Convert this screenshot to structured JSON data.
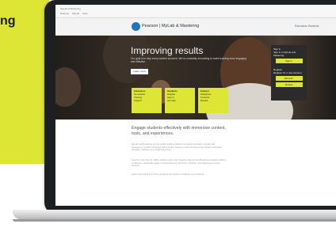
{
  "promo": {
    "text": "ng",
    "color": "#dde635"
  },
  "browser": {
    "tab_title": "MyLab & Mastering",
    "bookmarks": [
      "Pearson",
      "MyLab",
      "Help"
    ]
  },
  "site": {
    "brand": "Pearson | MyLab & Mastering",
    "nav_right": "Educators  Students",
    "logo_icon": "pearson-logo-icon"
  },
  "hero": {
    "title": "Improving results",
    "subtitle": "Our goal is to help every student succeed. We're constantly innovating to make learning more engaging and effective.",
    "button": "Learn more",
    "tiles": [
      {
        "title": "Educators",
        "items": [
          "Get started",
          "Training",
          "Support"
        ]
      },
      {
        "title": "Students",
        "items": [
          "Register",
          "Sign in",
          "Get help"
        ]
      },
      {
        "title": "Explore",
        "items": [
          "Disciplines",
          "Products",
          "Results"
        ]
      }
    ]
  },
  "signin": {
    "heading": "Sign in",
    "text": "Sign in to MyLab and Mastering",
    "sign_in_button": "Sign in",
    "register_heading": "Register",
    "register_text": "Register for a new account",
    "educator_button": "Educator",
    "student_button": "Student"
  },
  "content": {
    "heading": "Engage students effectively with immersive content, tools, and experiences.",
    "paragraphs": [
      "MyLab and Mastering are the world's leading collection of online homework, tutorial, and assessment products designed with a single purpose in mind: to improve the results of all higher education students, one student at a time.",
      "Used by more than 11 million students each year, Pearson's MyLab and Mastering programs deliver consistent, measurable gains in student learning outcomes, retention, and subsequent course success.",
      "Learn more about how these programs can improve results for your students."
    ]
  }
}
